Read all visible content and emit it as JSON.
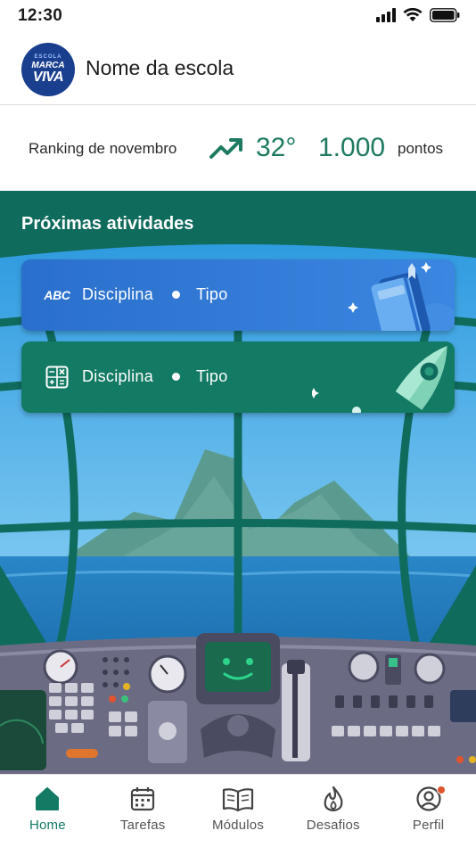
{
  "status_bar": {
    "time": "12:30"
  },
  "header": {
    "logo_text": [
      "ESCOLA",
      "MARCA",
      "VIVA"
    ],
    "school_name": "Nome da escola"
  },
  "ranking": {
    "label": "Ranking de novembro",
    "position": "32°",
    "points_value": "1.000",
    "points_label": "pontos"
  },
  "upcoming": {
    "title": "Próximas atividades",
    "cards": [
      {
        "icon": "abc-icon",
        "icon_text": "ABC",
        "discipline": "Disciplina",
        "type": "Tipo",
        "color": "#2f78d4"
      },
      {
        "icon": "calculator-icon",
        "discipline": "Disciplina",
        "type": "Tipo",
        "color": "#137a64"
      }
    ]
  },
  "bottom_nav": {
    "items": [
      {
        "label": "Home",
        "icon": "home-icon",
        "active": true
      },
      {
        "label": "Tarefas",
        "icon": "calendar-icon",
        "active": false
      },
      {
        "label": "Módulos",
        "icon": "book-icon",
        "active": false
      },
      {
        "label": "Desafios",
        "icon": "flame-icon",
        "active": false
      },
      {
        "label": "Perfil",
        "icon": "profile-icon",
        "active": false
      }
    ]
  },
  "colors": {
    "accent": "#1e7a60",
    "header_green": "#0f6b5c",
    "card_blue": "#2f78d4",
    "card_green": "#137a64",
    "notification": "#e0542e"
  }
}
